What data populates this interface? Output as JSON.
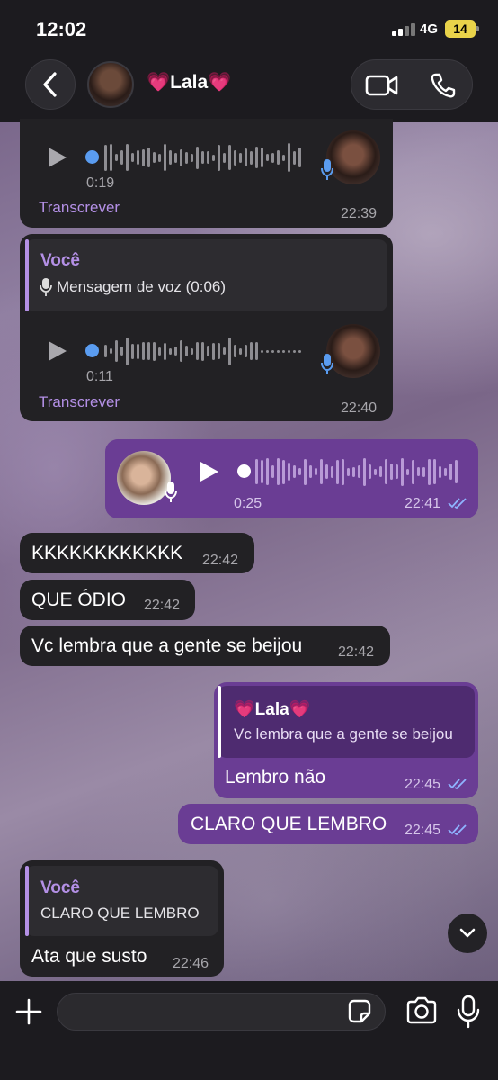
{
  "status": {
    "time": "12:02",
    "network": "4G",
    "battery": "14"
  },
  "header": {
    "contact_name": "💗Lala💗"
  },
  "messages": {
    "m1": {
      "duration": "0:19",
      "transcribe": "Transcrever",
      "time": "22:39"
    },
    "m2": {
      "reply_name": "Você",
      "reply_text": "Mensagem de voz (0:06)",
      "duration": "0:11",
      "transcribe": "Transcrever",
      "time": "22:40"
    },
    "m3": {
      "duration": "0:25",
      "time": "22:41"
    },
    "m4": {
      "text": "KKKKKKKKKKKK",
      "time": "22:42"
    },
    "m5": {
      "text": "QUE ÓDIO",
      "time": "22:42"
    },
    "m6": {
      "text": "Vc lembra que a gente se beijou",
      "time": "22:42"
    },
    "m7": {
      "reply_name": "💗Lala💗",
      "reply_text": "Vc lembra que a gente se beijou",
      "text": "Lembro não",
      "time": "22:45"
    },
    "m8": {
      "text": "CLARO QUE LEMBRO",
      "time": "22:45"
    },
    "m9": {
      "reply_name": "Você",
      "reply_text": "CLARO QUE LEMBRO",
      "text": "Ata que susto",
      "time": "22:46"
    }
  },
  "colors": {
    "incoming": "#222124",
    "outgoing": "#6a3d94",
    "accent": "#b490e6",
    "unplayed_dot": "#5a9cf0",
    "read_checks": "#8fb4ff"
  },
  "icons": [
    "back-chevron-icon",
    "video-call-icon",
    "phone-icon",
    "play-icon",
    "microphone-icon",
    "double-check-icon",
    "chevron-down-icon",
    "plus-icon",
    "sticker-icon",
    "camera-icon"
  ]
}
